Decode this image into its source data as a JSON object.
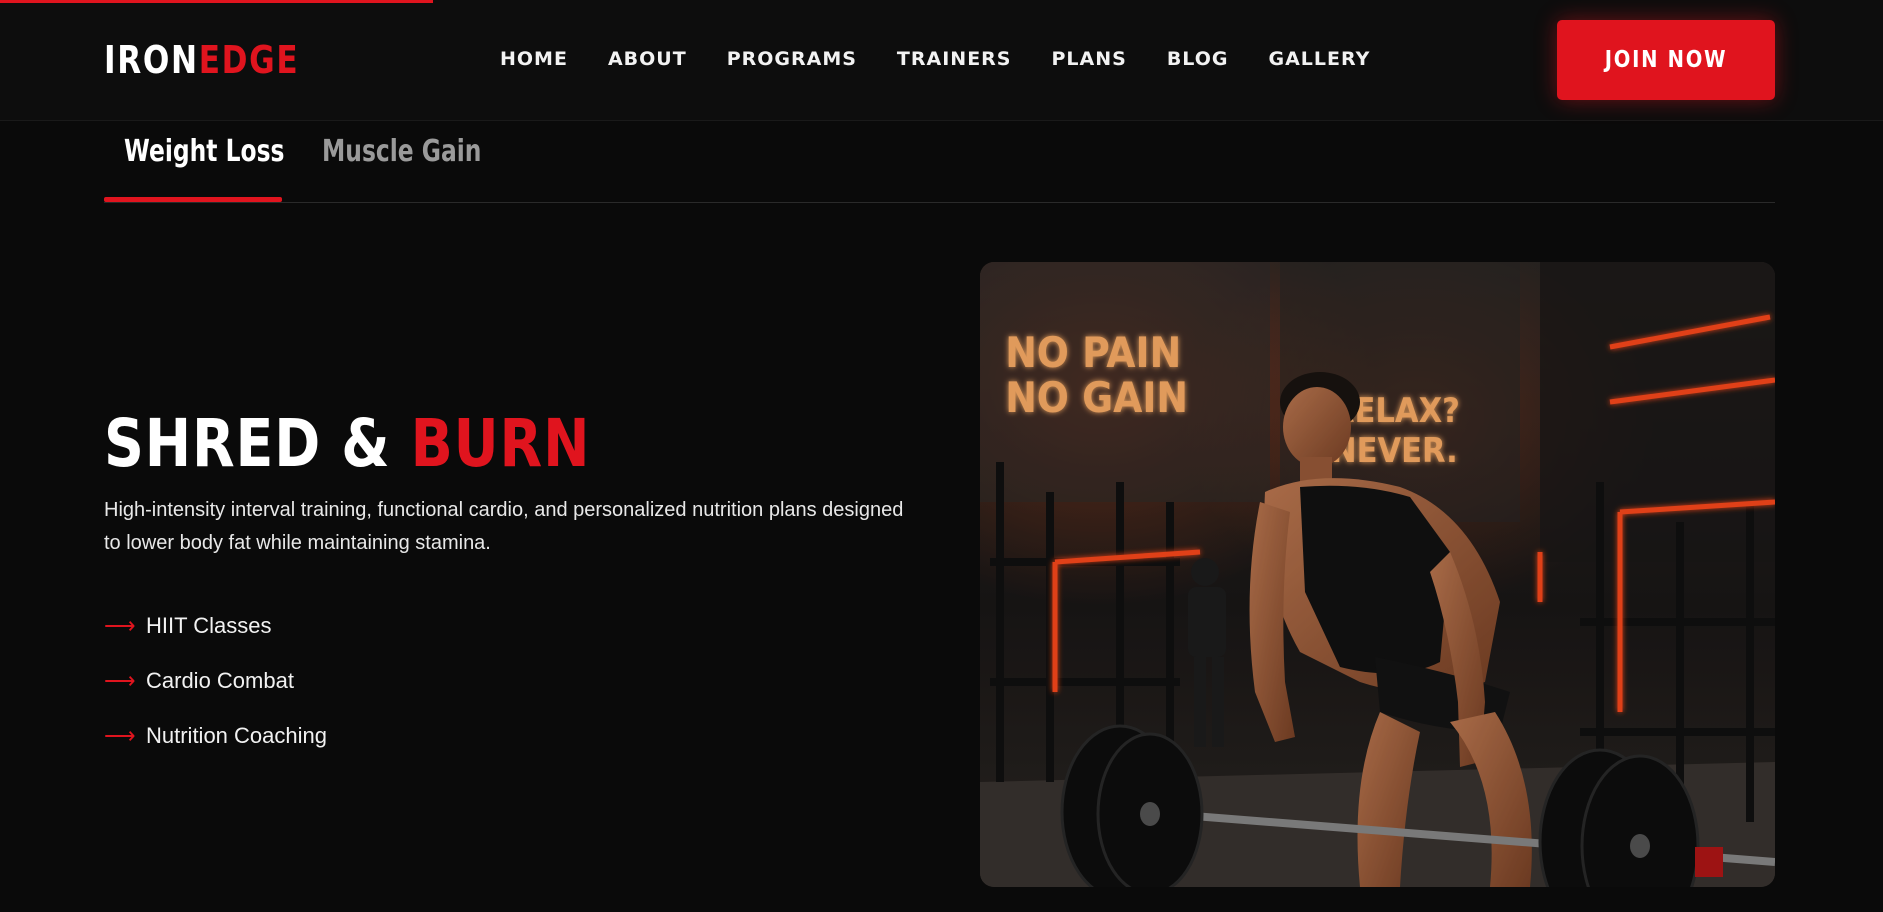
{
  "progress": {
    "fraction": 0.23
  },
  "brand": {
    "part1": "IRON",
    "part2": "EDGE",
    "accent_color": "#e0141e"
  },
  "nav": {
    "items": [
      "HOME",
      "ABOUT",
      "PROGRAMS",
      "TRAINERS",
      "PLANS",
      "BLOG",
      "GALLERY"
    ],
    "cta_label": "JOIN NOW"
  },
  "tabs": {
    "items": [
      {
        "label": "Weight Loss",
        "active": true
      },
      {
        "label": "Muscle Gain",
        "active": false
      }
    ]
  },
  "hero": {
    "title_part1": "SHRED & ",
    "title_part2": "BURN",
    "description": "High-intensity interval training, functional cardio, and personalized nutrition plans designed to lower body fat while maintaining stamina.",
    "features": [
      "HIIT Classes",
      "Cardio Combat",
      "Nutrition Coaching"
    ],
    "feature_icon": "arrow-right-icon"
  },
  "photo": {
    "neon_sign_1_line1": "NO PAIN",
    "neon_sign_1_line2": "NO GAIN",
    "neon_sign_2_line1": "RELAX?",
    "neon_sign_2_line2": "NEVER."
  }
}
